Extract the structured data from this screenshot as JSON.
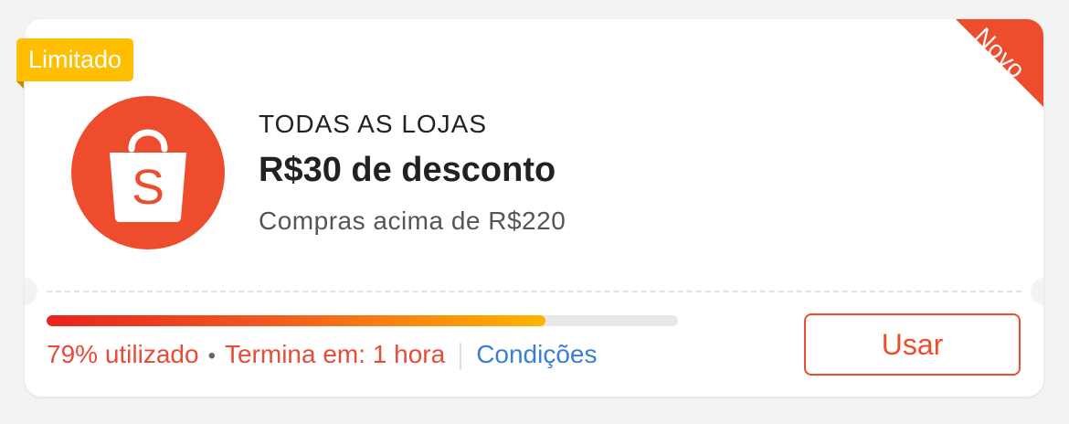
{
  "badge": {
    "label": "Limitado",
    "color": "#ffbf00"
  },
  "ribbon": {
    "label": "Novo",
    "color": "#ee4d2d"
  },
  "logo": {
    "icon": "shopee-bag-icon",
    "letter": "S",
    "color": "#ee4d2d"
  },
  "voucher": {
    "scope": "TODAS AS LOJAS",
    "title": "R$30 de desconto",
    "subtitle": "Compras acima de R$220"
  },
  "usage": {
    "percent": 79,
    "used_label": "79% utilizado",
    "separator": "•",
    "ends_label": "Termina em: 1 hora",
    "conditions_label": "Condições"
  },
  "actions": {
    "use_label": "Usar"
  },
  "colors": {
    "accent": "#ee4d2d",
    "link": "#3a7fd4",
    "warning_text": "#e84b3a"
  }
}
